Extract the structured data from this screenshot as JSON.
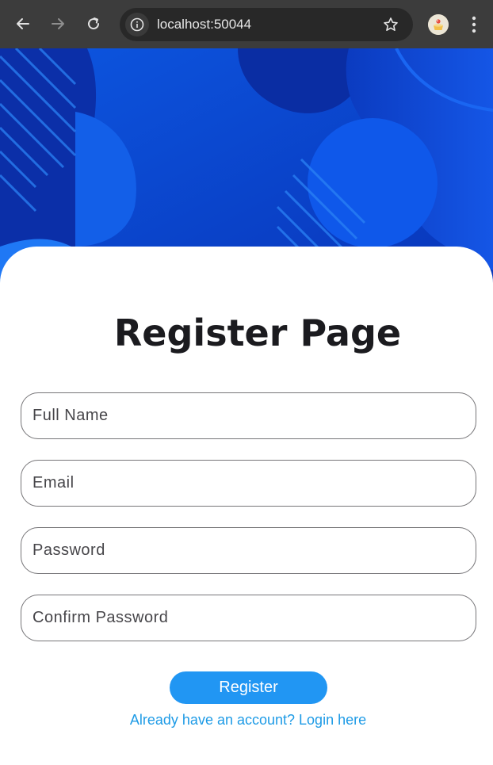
{
  "browser": {
    "url": "localhost:50044",
    "icons": {
      "back": "arrow-left-icon",
      "forward": "arrow-right-icon",
      "reload": "reload-icon",
      "info": "info-icon",
      "bookmark": "star-icon",
      "profile": "profile-avatar-icon",
      "menu": "more-vert-icon"
    }
  },
  "page": {
    "title": "Register Page",
    "fields": {
      "full_name_placeholder": "Full Name",
      "email_placeholder": "Email",
      "password_placeholder": "Password",
      "confirm_password_placeholder": "Confirm Password"
    },
    "register_label": "Register",
    "login_link": "Already have an account? Login here"
  },
  "colors": {
    "browser_bar": "#3c3c3c",
    "hero_blue": "#0a3fc9",
    "button": "#2196f3",
    "link": "#1e9be6",
    "title": "#1b1b1f"
  }
}
